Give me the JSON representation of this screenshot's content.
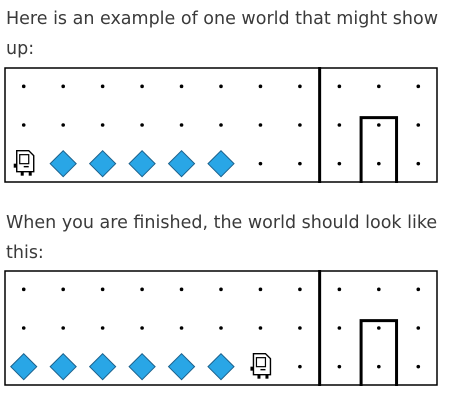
{
  "intro_text": "Here is an example of one world that might show up:",
  "after_text": "When you are finished, the world should look like this:",
  "world_before": {
    "cols": 11,
    "rows": 3,
    "wall_after_col": 8,
    "home_icon": "door-icon",
    "karel_icon": "karel-robot-icon",
    "beeper_icon": "beeper-diamond-icon",
    "karel": {
      "col": 1,
      "row": 1,
      "facing": "east"
    },
    "beepers": [
      2,
      3,
      4,
      5,
      6
    ],
    "door_col": 10
  },
  "world_after": {
    "cols": 11,
    "rows": 3,
    "wall_after_col": 8,
    "home_icon": "door-icon",
    "karel_icon": "karel-robot-icon",
    "beeper_icon": "beeper-diamond-icon",
    "karel": {
      "col": 7,
      "row": 1,
      "facing": "east"
    },
    "beepers": [
      1,
      2,
      3,
      4,
      5,
      6
    ],
    "door_col": 10
  },
  "colors": {
    "text": "#3a3a3a",
    "beeper_fill": "#29a6e6",
    "beeper_stroke": "#1a5f8a",
    "wall": "#000000",
    "dot": "#000000",
    "border": "#000000"
  }
}
